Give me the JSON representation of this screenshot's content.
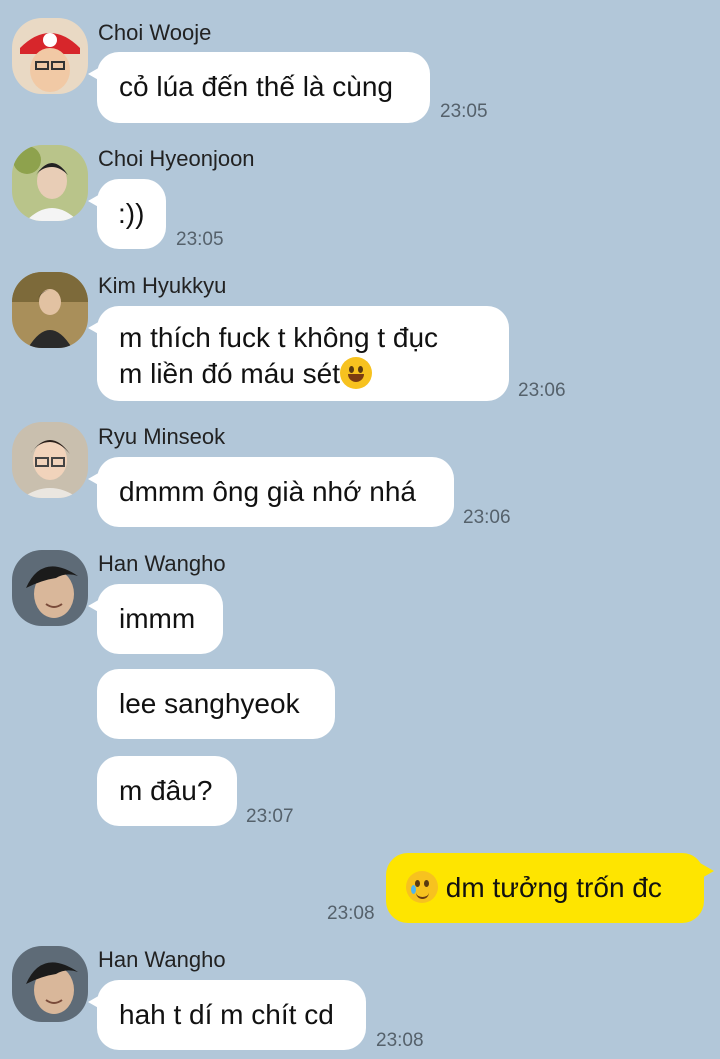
{
  "messages": [
    {
      "sender": "Choi Wooje",
      "text": "cỏ lúa đến thế là cùng",
      "time": "23:05"
    },
    {
      "sender": "Choi Hyeonjoon",
      "text": ":))",
      "time": "23:05"
    },
    {
      "sender": "Kim Hyukkyu",
      "line1": "m thích fuck t không t đục",
      "line2": "m liền đó máu sét",
      "time": "23:06"
    },
    {
      "sender": "Ryu Minseok",
      "text": "dmmm ông già nhớ nhá",
      "time": "23:06"
    },
    {
      "sender": "Han Wangho",
      "texts": [
        "immm",
        "lee sanghyeok",
        "m đâu?"
      ],
      "time": "23:07"
    },
    {
      "sender": "me",
      "text": "dm tưởng trốn đc",
      "time": "23:08"
    },
    {
      "sender": "Han Wangho",
      "text": "hah t dí m chít cd",
      "time": "23:08"
    }
  ],
  "icons": {
    "m3_emoji": "grinning-face-emoji",
    "m6_emoji": "smiling-face-with-tear-emoji"
  },
  "colors": {
    "background": "#b2c7d9",
    "incoming_bubble": "#ffffff",
    "outgoing_bubble": "#fee500"
  }
}
